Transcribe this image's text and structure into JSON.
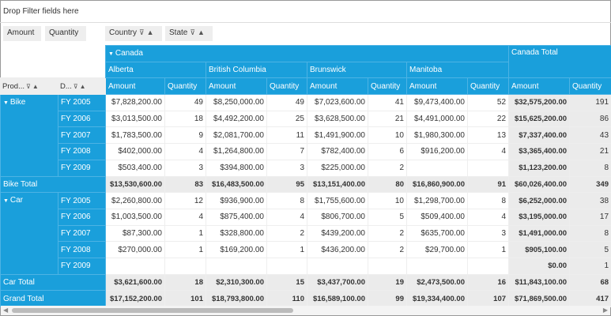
{
  "filter_area": "Drop Filter fields here",
  "values_fields": [
    "Amount",
    "Quantity"
  ],
  "column_fields": [
    "Country",
    "State"
  ],
  "row_fields": [
    "Prod...",
    "D..."
  ],
  "country": "Canada",
  "country_total": "Canada Total",
  "states": [
    "Alberta",
    "British Columbia",
    "Brunswick",
    "Manitoba"
  ],
  "measures": [
    "Amount",
    "Quantity"
  ],
  "colors": {
    "header": "#1a9fdb",
    "total": "#ebebeb"
  },
  "rows": [
    {
      "product": "Bike",
      "year": "FY 2005",
      "type": "data",
      "first": true,
      "values": [
        "$7,828,200.00",
        "49",
        "$8,250,000.00",
        "49",
        "$7,023,600.00",
        "41",
        "$9,473,400.00",
        "52",
        "$32,575,200.00",
        "191"
      ]
    },
    {
      "year": "FY 2006",
      "type": "data",
      "values": [
        "$3,013,500.00",
        "18",
        "$4,492,200.00",
        "25",
        "$3,628,500.00",
        "21",
        "$4,491,000.00",
        "22",
        "$15,625,200.00",
        "86"
      ]
    },
    {
      "year": "FY 2007",
      "type": "data",
      "values": [
        "$1,783,500.00",
        "9",
        "$2,081,700.00",
        "11",
        "$1,491,900.00",
        "10",
        "$1,980,300.00",
        "13",
        "$7,337,400.00",
        "43"
      ]
    },
    {
      "year": "FY 2008",
      "type": "data",
      "values": [
        "$402,000.00",
        "4",
        "$1,264,800.00",
        "7",
        "$782,400.00",
        "6",
        "$916,200.00",
        "4",
        "$3,365,400.00",
        "21"
      ]
    },
    {
      "year": "FY 2009",
      "type": "data",
      "values": [
        "$503,400.00",
        "3",
        "$394,800.00",
        "3",
        "$225,000.00",
        "2",
        "",
        "",
        "$1,123,200.00",
        "8"
      ]
    },
    {
      "label": "Bike Total",
      "type": "total",
      "values": [
        "$13,530,600.00",
        "83",
        "$16,483,500.00",
        "95",
        "$13,151,400.00",
        "80",
        "$16,860,900.00",
        "91",
        "$60,026,400.00",
        "349"
      ]
    },
    {
      "product": "Car",
      "year": "FY 2005",
      "type": "data",
      "first": true,
      "values": [
        "$2,260,800.00",
        "12",
        "$936,900.00",
        "8",
        "$1,755,600.00",
        "10",
        "$1,298,700.00",
        "8",
        "$6,252,000.00",
        "38"
      ]
    },
    {
      "year": "FY 2006",
      "type": "data",
      "values": [
        "$1,003,500.00",
        "4",
        "$875,400.00",
        "4",
        "$806,700.00",
        "5",
        "$509,400.00",
        "4",
        "$3,195,000.00",
        "17"
      ]
    },
    {
      "year": "FY 2007",
      "type": "data",
      "values": [
        "$87,300.00",
        "1",
        "$328,800.00",
        "2",
        "$439,200.00",
        "2",
        "$635,700.00",
        "3",
        "$1,491,000.00",
        "8"
      ]
    },
    {
      "year": "FY 2008",
      "type": "data",
      "values": [
        "$270,000.00",
        "1",
        "$169,200.00",
        "1",
        "$436,200.00",
        "2",
        "$29,700.00",
        "1",
        "$905,100.00",
        "5"
      ]
    },
    {
      "year": "FY 2009",
      "type": "data",
      "values": [
        "",
        "",
        "",
        "",
        "",
        "",
        "",
        "",
        "$0.00",
        "1"
      ]
    },
    {
      "label": "Car Total",
      "type": "total",
      "values": [
        "$3,621,600.00",
        "18",
        "$2,310,300.00",
        "15",
        "$3,437,700.00",
        "19",
        "$2,473,500.00",
        "16",
        "$11,843,100.00",
        "68"
      ]
    },
    {
      "label": "Grand Total",
      "type": "total",
      "values": [
        "$17,152,200.00",
        "101",
        "$18,793,800.00",
        "110",
        "$16,589,100.00",
        "99",
        "$19,334,400.00",
        "107",
        "$71,869,500.00",
        "417"
      ]
    }
  ]
}
